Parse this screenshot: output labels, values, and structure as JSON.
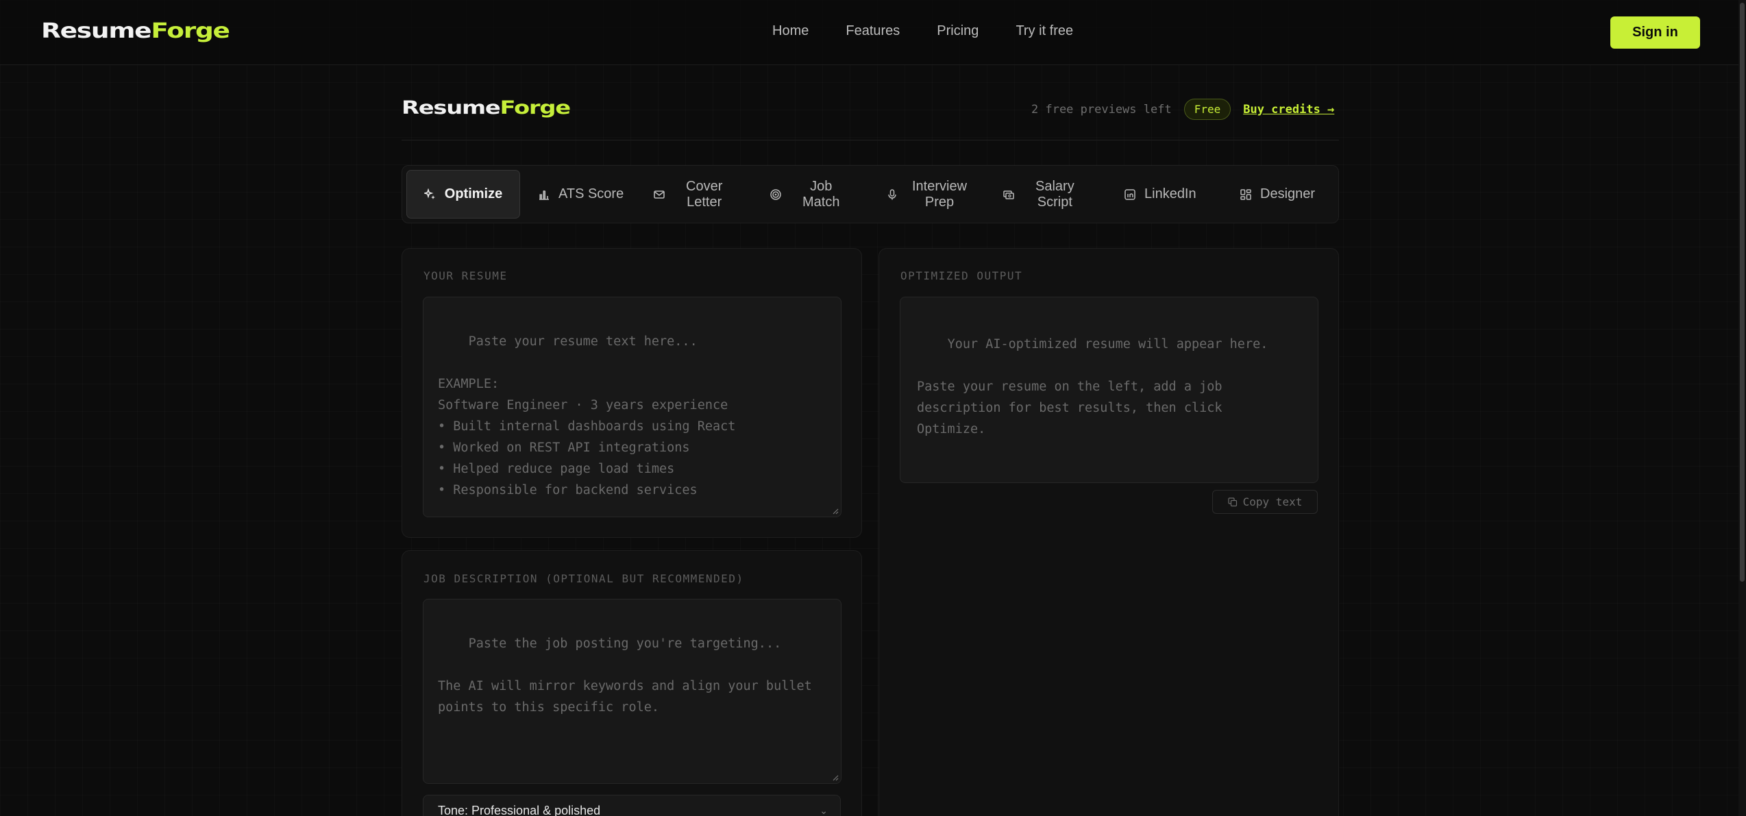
{
  "brand": {
    "part1": "Resume",
    "part2": "Forge"
  },
  "nav": {
    "links": [
      "Home",
      "Features",
      "Pricing",
      "Try it free"
    ],
    "signin": "Sign in"
  },
  "credits": {
    "remaining_text": "2 free previews left",
    "plan_badge": "Free",
    "buy_link": "Buy credits →"
  },
  "tabs": [
    {
      "label": "Optimize",
      "icon": "sparkles-icon",
      "active": true
    },
    {
      "label": "ATS Score",
      "icon": "bar-chart-icon",
      "active": false
    },
    {
      "label": "Cover\nLetter",
      "icon": "mail-icon",
      "active": false
    },
    {
      "label": "Job\nMatch",
      "icon": "target-icon",
      "active": false
    },
    {
      "label": "Interview\nPrep",
      "icon": "microphone-icon",
      "active": false
    },
    {
      "label": "Salary\nScript",
      "icon": "money-icon",
      "active": false
    },
    {
      "label": "LinkedIn",
      "icon": "linkedin-icon",
      "active": false
    },
    {
      "label": "Designer",
      "icon": "layout-icon",
      "active": false
    }
  ],
  "resume_panel": {
    "label": "YOUR RESUME",
    "placeholder": "Paste your resume text here...\n\nEXAMPLE:\nSoftware Engineer · 3 years experience\n• Built internal dashboards using React\n• Worked on REST API integrations\n• Helped reduce page load times\n• Responsible for backend services"
  },
  "job_panel": {
    "label": "JOB DESCRIPTION (OPTIONAL BUT RECOMMENDED)",
    "placeholder": "Paste the job posting you're targeting...\n\nThe AI will mirror keywords and align your bullet\npoints to this specific role."
  },
  "tone_select": {
    "value": "Tone: Professional & polished"
  },
  "output_panel": {
    "label": "OPTIMIZED OUTPUT",
    "placeholder": "Your AI-optimized resume will appear here.\n\nPaste your resume on the left, add a job\ndescription for best results, then click\nOptimize.",
    "copy_button": "Copy text"
  },
  "colors": {
    "accent": "#c8ef36",
    "background": "#0c0c0c",
    "panel": "#111111"
  }
}
